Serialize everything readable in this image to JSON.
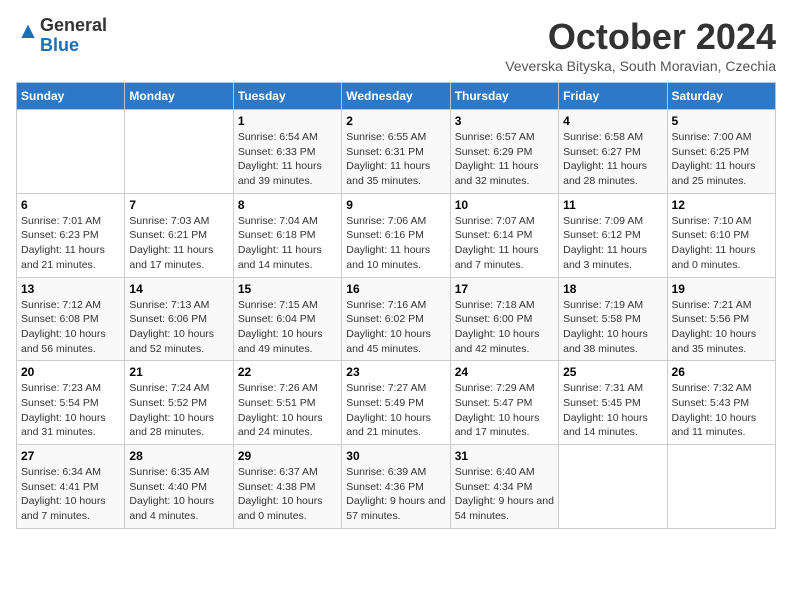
{
  "header": {
    "logo_general": "General",
    "logo_blue": "Blue",
    "month_title": "October 2024",
    "subtitle": "Veverska Bityska, South Moravian, Czechia"
  },
  "days_of_week": [
    "Sunday",
    "Monday",
    "Tuesday",
    "Wednesday",
    "Thursday",
    "Friday",
    "Saturday"
  ],
  "weeks": [
    [
      {
        "day": "",
        "info": ""
      },
      {
        "day": "",
        "info": ""
      },
      {
        "day": "1",
        "info": "Sunrise: 6:54 AM\nSunset: 6:33 PM\nDaylight: 11 hours and 39 minutes."
      },
      {
        "day": "2",
        "info": "Sunrise: 6:55 AM\nSunset: 6:31 PM\nDaylight: 11 hours and 35 minutes."
      },
      {
        "day": "3",
        "info": "Sunrise: 6:57 AM\nSunset: 6:29 PM\nDaylight: 11 hours and 32 minutes."
      },
      {
        "day": "4",
        "info": "Sunrise: 6:58 AM\nSunset: 6:27 PM\nDaylight: 11 hours and 28 minutes."
      },
      {
        "day": "5",
        "info": "Sunrise: 7:00 AM\nSunset: 6:25 PM\nDaylight: 11 hours and 25 minutes."
      }
    ],
    [
      {
        "day": "6",
        "info": "Sunrise: 7:01 AM\nSunset: 6:23 PM\nDaylight: 11 hours and 21 minutes."
      },
      {
        "day": "7",
        "info": "Sunrise: 7:03 AM\nSunset: 6:21 PM\nDaylight: 11 hours and 17 minutes."
      },
      {
        "day": "8",
        "info": "Sunrise: 7:04 AM\nSunset: 6:18 PM\nDaylight: 11 hours and 14 minutes."
      },
      {
        "day": "9",
        "info": "Sunrise: 7:06 AM\nSunset: 6:16 PM\nDaylight: 11 hours and 10 minutes."
      },
      {
        "day": "10",
        "info": "Sunrise: 7:07 AM\nSunset: 6:14 PM\nDaylight: 11 hours and 7 minutes."
      },
      {
        "day": "11",
        "info": "Sunrise: 7:09 AM\nSunset: 6:12 PM\nDaylight: 11 hours and 3 minutes."
      },
      {
        "day": "12",
        "info": "Sunrise: 7:10 AM\nSunset: 6:10 PM\nDaylight: 11 hours and 0 minutes."
      }
    ],
    [
      {
        "day": "13",
        "info": "Sunrise: 7:12 AM\nSunset: 6:08 PM\nDaylight: 10 hours and 56 minutes."
      },
      {
        "day": "14",
        "info": "Sunrise: 7:13 AM\nSunset: 6:06 PM\nDaylight: 10 hours and 52 minutes."
      },
      {
        "day": "15",
        "info": "Sunrise: 7:15 AM\nSunset: 6:04 PM\nDaylight: 10 hours and 49 minutes."
      },
      {
        "day": "16",
        "info": "Sunrise: 7:16 AM\nSunset: 6:02 PM\nDaylight: 10 hours and 45 minutes."
      },
      {
        "day": "17",
        "info": "Sunrise: 7:18 AM\nSunset: 6:00 PM\nDaylight: 10 hours and 42 minutes."
      },
      {
        "day": "18",
        "info": "Sunrise: 7:19 AM\nSunset: 5:58 PM\nDaylight: 10 hours and 38 minutes."
      },
      {
        "day": "19",
        "info": "Sunrise: 7:21 AM\nSunset: 5:56 PM\nDaylight: 10 hours and 35 minutes."
      }
    ],
    [
      {
        "day": "20",
        "info": "Sunrise: 7:23 AM\nSunset: 5:54 PM\nDaylight: 10 hours and 31 minutes."
      },
      {
        "day": "21",
        "info": "Sunrise: 7:24 AM\nSunset: 5:52 PM\nDaylight: 10 hours and 28 minutes."
      },
      {
        "day": "22",
        "info": "Sunrise: 7:26 AM\nSunset: 5:51 PM\nDaylight: 10 hours and 24 minutes."
      },
      {
        "day": "23",
        "info": "Sunrise: 7:27 AM\nSunset: 5:49 PM\nDaylight: 10 hours and 21 minutes."
      },
      {
        "day": "24",
        "info": "Sunrise: 7:29 AM\nSunset: 5:47 PM\nDaylight: 10 hours and 17 minutes."
      },
      {
        "day": "25",
        "info": "Sunrise: 7:31 AM\nSunset: 5:45 PM\nDaylight: 10 hours and 14 minutes."
      },
      {
        "day": "26",
        "info": "Sunrise: 7:32 AM\nSunset: 5:43 PM\nDaylight: 10 hours and 11 minutes."
      }
    ],
    [
      {
        "day": "27",
        "info": "Sunrise: 6:34 AM\nSunset: 4:41 PM\nDaylight: 10 hours and 7 minutes."
      },
      {
        "day": "28",
        "info": "Sunrise: 6:35 AM\nSunset: 4:40 PM\nDaylight: 10 hours and 4 minutes."
      },
      {
        "day": "29",
        "info": "Sunrise: 6:37 AM\nSunset: 4:38 PM\nDaylight: 10 hours and 0 minutes."
      },
      {
        "day": "30",
        "info": "Sunrise: 6:39 AM\nSunset: 4:36 PM\nDaylight: 9 hours and 57 minutes."
      },
      {
        "day": "31",
        "info": "Sunrise: 6:40 AM\nSunset: 4:34 PM\nDaylight: 9 hours and 54 minutes."
      },
      {
        "day": "",
        "info": ""
      },
      {
        "day": "",
        "info": ""
      }
    ]
  ]
}
